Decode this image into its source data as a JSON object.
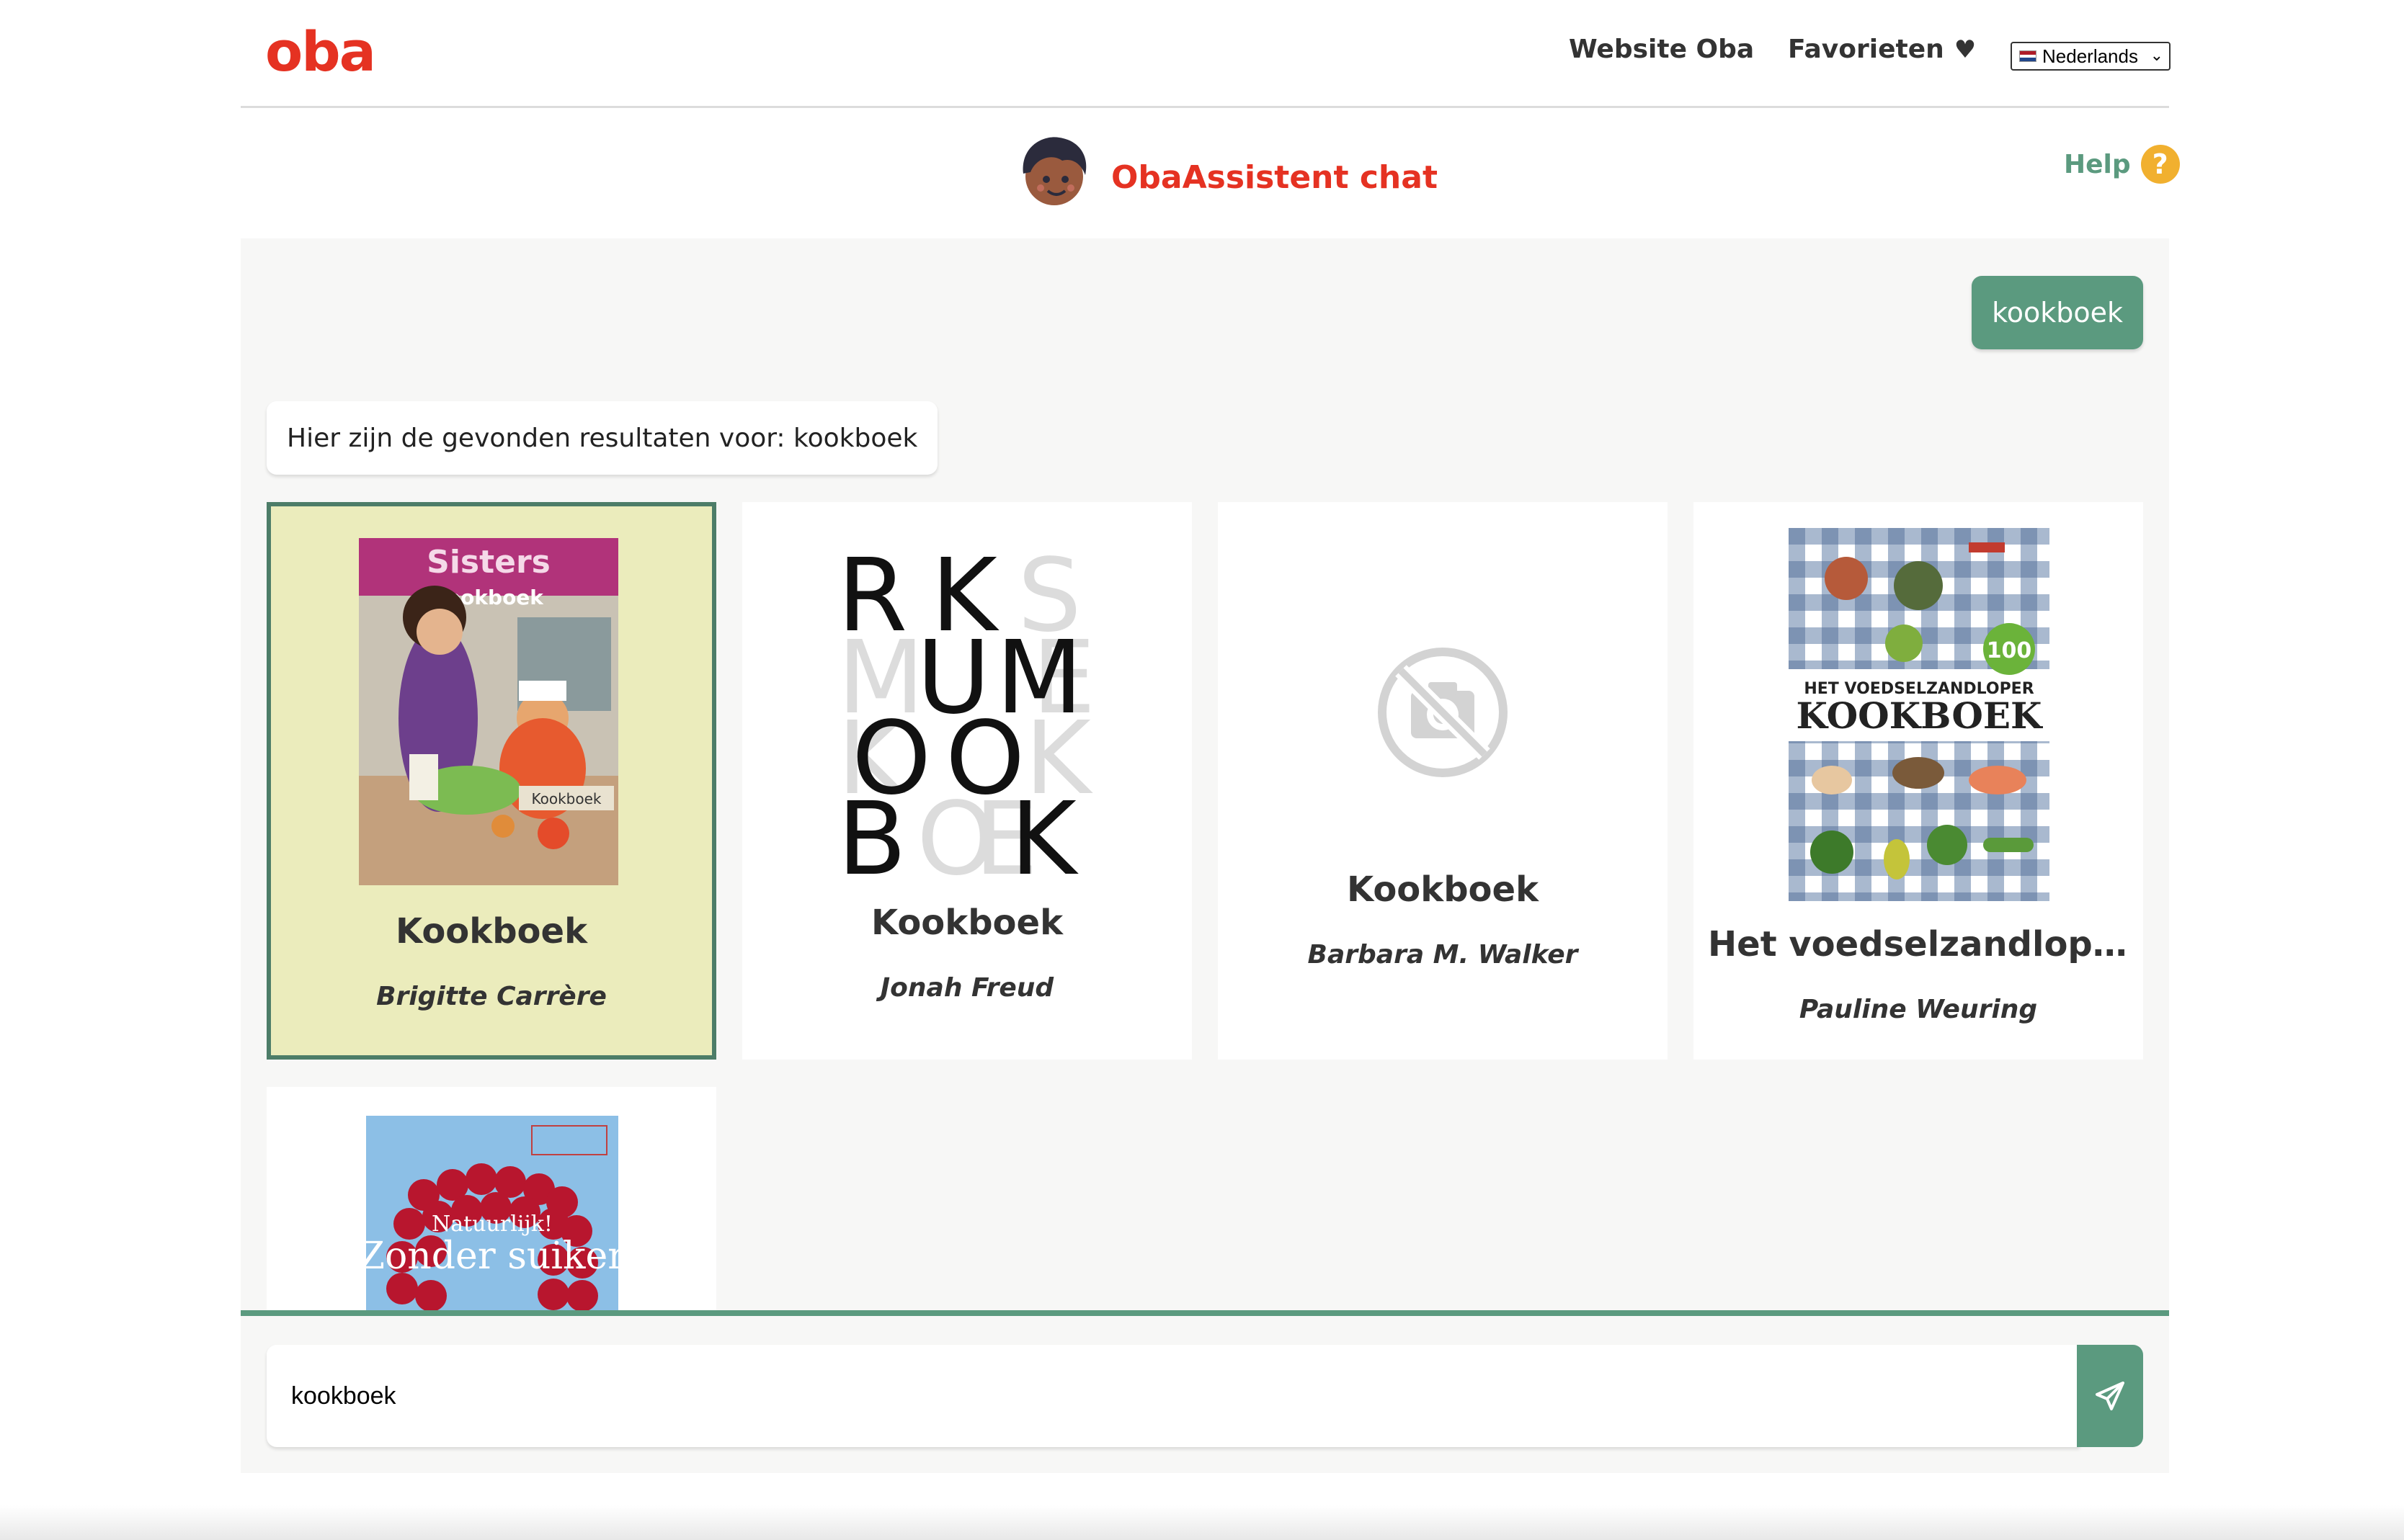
{
  "nav": {
    "logo": "oba",
    "website_link": "Website Oba",
    "favorites_link": "Favorieten",
    "language": "Nederlands"
  },
  "chat": {
    "title": "ObaAssistent chat",
    "help_label": "Help",
    "help_icon": "?",
    "user_message": "kookboek",
    "bot_message": "Hier zijn de gevonden resultaten voor: kookboek"
  },
  "results": [
    {
      "title": "Kookboek",
      "author": "Brigitte Carrère",
      "selected": true,
      "cover_title": "Sisters",
      "cover_subtitle": "kookboek",
      "cover_tag": "Kookboek"
    },
    {
      "title": "Kookboek",
      "author": "Jonah Freud",
      "selected": false
    },
    {
      "title": "Kookboek",
      "author": "Barbara M. Walker",
      "selected": false
    },
    {
      "title": "Het voedselzandloper ...",
      "author": "Pauline Weuring",
      "selected": false,
      "cover_title": "KOOKBOEK",
      "cover_subtitle": "HET VOEDSELZANDLOPER",
      "cover_badge": "100"
    },
    {
      "cover_title": "Zonder suiker",
      "cover_subtitle": "Natuurlijk!"
    }
  ],
  "input": {
    "value": "kookboek"
  },
  "colors": {
    "brand_red": "#e53222",
    "accent_green": "#5b9a7f",
    "selected_bg": "#ebecbc",
    "help_yellow": "#f1b02f"
  }
}
